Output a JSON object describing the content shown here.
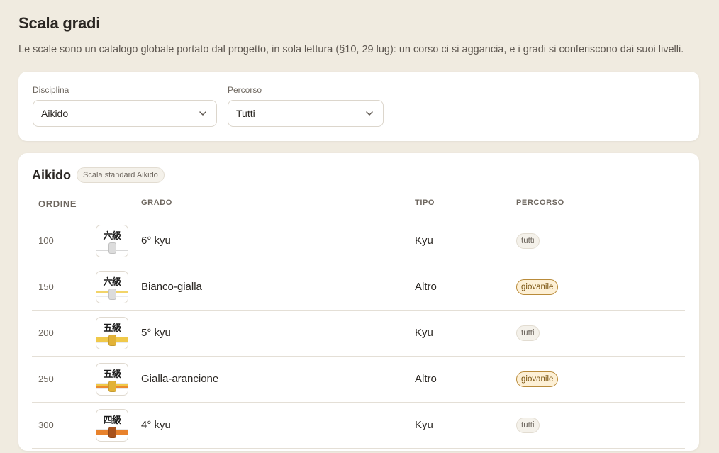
{
  "page": {
    "title": "Scala gradi",
    "description": "Le scale sono un catalogo globale portato dal progetto, in sola lettura (§10, 29 lug): un corso ci si aggancia, e i gradi si conferiscono dai suoi livelli."
  },
  "filters": {
    "discipline": {
      "label": "Disciplina",
      "value": "Aikido"
    },
    "path": {
      "label": "Percorso",
      "value": "Tutti"
    }
  },
  "scale": {
    "name": "Aikido",
    "badge": "Scala standard Aikido",
    "columns": {
      "order": "ORDINE",
      "icon": "",
      "grade": "GRADO",
      "type": "TIPO",
      "path": "PERCORSO"
    },
    "rows": [
      {
        "order": "100",
        "kanji": "六級",
        "grade": "6° kyu",
        "type": "Kyu",
        "path": "tutti",
        "band_top": "#ffffff",
        "band_bottom": "#ffffff",
        "knot": "#dcdcdc"
      },
      {
        "order": "150",
        "kanji": "六級",
        "grade": "Bianco-gialla",
        "type": "Altro",
        "path": "giovanile",
        "band_top": "#f2d469",
        "band_bottom": "#ffffff",
        "knot": "#dcdcdc"
      },
      {
        "order": "200",
        "kanji": "五級",
        "grade": "5° kyu",
        "type": "Kyu",
        "path": "tutti",
        "band_top": "#f0c94a",
        "band_bottom": "#f0c94a",
        "knot": "#e2b237"
      },
      {
        "order": "250",
        "kanji": "五級",
        "grade": "Gialla-arancione",
        "type": "Altro",
        "path": "giovanile",
        "band_top": "#f0c94a",
        "band_bottom": "#ea8a2e",
        "knot": "#e2b237"
      },
      {
        "order": "300",
        "kanji": "四級",
        "grade": "4° kyu",
        "type": "Kyu",
        "path": "tutti",
        "band_top": "#e8822c",
        "band_bottom": "#e8822c",
        "knot": "#a8521c"
      }
    ]
  },
  "colors": {
    "background": "#f0ebe0",
    "card": "#ffffff",
    "pill_giovanile_border": "#b98b3a",
    "pill_giovanile_bg": "#fdf0d6"
  }
}
